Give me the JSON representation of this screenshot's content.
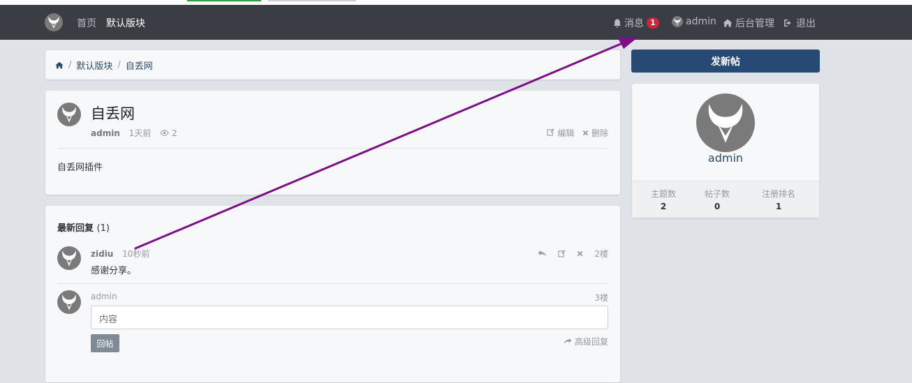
{
  "navbar": {
    "home": "首页",
    "active_section": "默认版块",
    "messages_label": "消息",
    "messages_count": "1",
    "username": "admin",
    "admin_label": "后台管理",
    "logout_label": "退出"
  },
  "breadcrumb": {
    "section": "默认版块",
    "current": "自丢网"
  },
  "thread": {
    "title": "自丢网",
    "author": "admin",
    "time": "1天前",
    "views": "2",
    "edit_label": "编辑",
    "delete_label": "删除",
    "content": "自丢网插件"
  },
  "replies": {
    "title": "最新回复",
    "count": "(1)",
    "items": [
      {
        "author": "zidiu",
        "time": "10秒前",
        "content": "感谢分享。",
        "floor": "2楼"
      }
    ],
    "form": {
      "user": "admin",
      "floor": "3楼",
      "placeholder": "内容",
      "submit_label": "回帖",
      "advanced_label": "高级回复"
    }
  },
  "sidebar": {
    "new_post_label": "发新帖",
    "profile_name": "admin",
    "stats": [
      {
        "label": "主题数",
        "value": "2"
      },
      {
        "label": "帖子数",
        "value": "0"
      },
      {
        "label": "注册排名",
        "value": "1"
      }
    ]
  },
  "colors": {
    "navbar_bg": "#3a3e44",
    "badge": "#d0253a",
    "primary_button": "#264a74",
    "annotation_arrow": "#7a0f86"
  }
}
